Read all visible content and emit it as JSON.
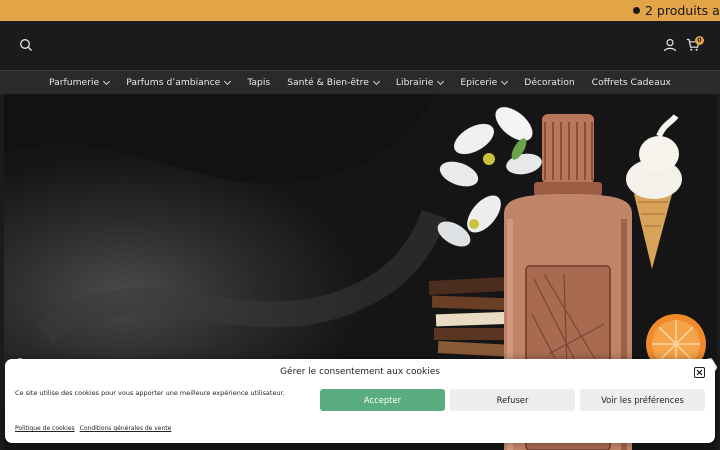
{
  "promo": {
    "text": "2 produits ach"
  },
  "header": {
    "search_icon": "search-icon",
    "account_icon": "user-icon",
    "cart_icon": "cart-icon",
    "cart_count": "0"
  },
  "nav": {
    "items": [
      {
        "label": "Parfumerie",
        "has_dropdown": true
      },
      {
        "label": "Parfums d’ambiance",
        "has_dropdown": true
      },
      {
        "label": "Tapis",
        "has_dropdown": false
      },
      {
        "label": "Santé & Bien-être",
        "has_dropdown": true
      },
      {
        "label": "Librairie",
        "has_dropdown": true
      },
      {
        "label": "Epicerie",
        "has_dropdown": true
      },
      {
        "label": "Décoration",
        "has_dropdown": false
      },
      {
        "label": "Coffrets Cadeaux",
        "has_dropdown": false
      }
    ]
  },
  "hero": {
    "prev_arrow": "❮",
    "next_arrow": "❯"
  },
  "cookie": {
    "title": "Gérer le consentement aux cookies",
    "message": "Ce site utilise des cookies pour vous apporter une meilleure expérience utilisateur.",
    "accept": "Accepter",
    "refuse": "Refuser",
    "preferences": "Voir les préférences",
    "policy_link": "Politique de cookies",
    "terms_link": "Conditions générales de vente"
  },
  "colors": {
    "promo_bg": "#e2a447",
    "header_bg": "#1b1b1d",
    "nav_bg": "#2a2a2c",
    "accept_bg": "#5aad7e"
  }
}
